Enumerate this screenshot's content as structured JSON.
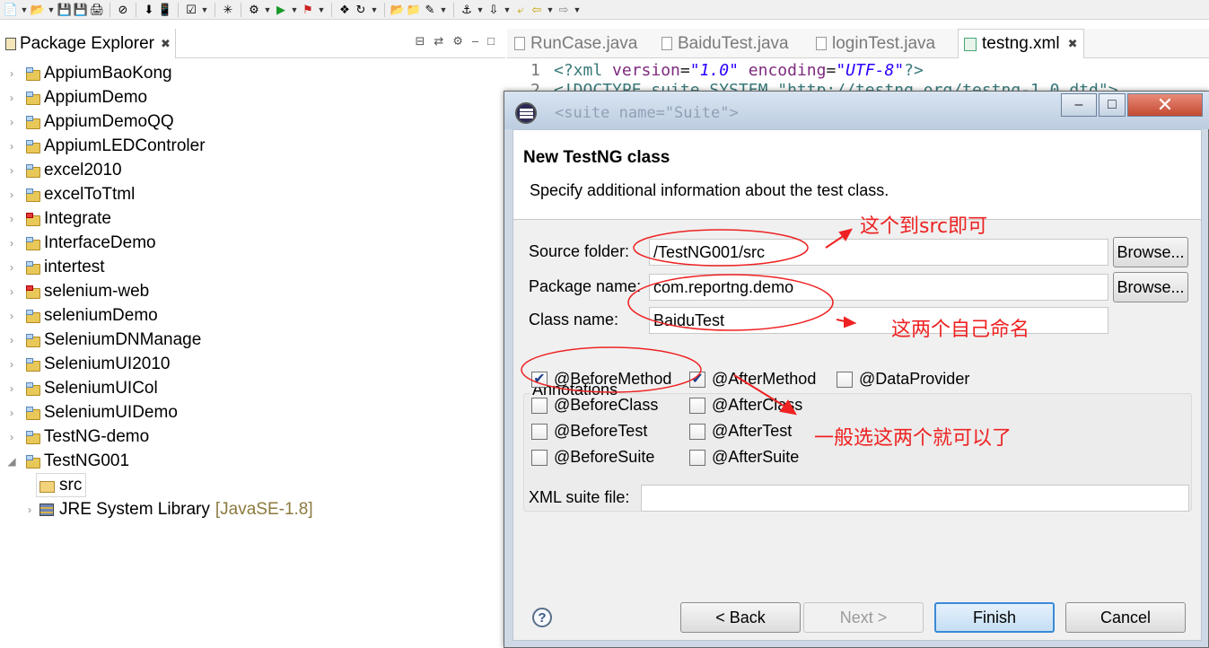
{
  "toolbar": {
    "icons": [
      "new-icon",
      "open-icon",
      "save-icon",
      "save-all-icon",
      "print-icon",
      "skip-breakpoints-icon",
      "download-icon",
      "phone-icon",
      "checkbox-icon",
      "new-class-icon",
      "debug-icon",
      "run-icon",
      "external-tools-icon",
      "package-icon",
      "refresh-icon",
      "open-folder-icon",
      "folder-icon",
      "pen-icon",
      "pin-icon",
      "next-icon",
      "prev-icon",
      "back-icon",
      "forward-icon"
    ]
  },
  "explorer": {
    "tab_label": "Package Explorer",
    "projects": [
      {
        "label": "AppiumBaoKong",
        "error": false
      },
      {
        "label": "AppiumDemo",
        "error": false
      },
      {
        "label": "AppiumDemoQQ",
        "error": false
      },
      {
        "label": "AppiumLEDControler",
        "error": false
      },
      {
        "label": "excel2010",
        "error": false
      },
      {
        "label": "excelToTtml",
        "error": false
      },
      {
        "label": "Integrate",
        "error": true
      },
      {
        "label": "InterfaceDemo",
        "error": false
      },
      {
        "label": "intertest",
        "error": false
      },
      {
        "label": "selenium-web",
        "error": true
      },
      {
        "label": "seleniumDemo",
        "error": false
      },
      {
        "label": "SeleniumDNManage",
        "error": false
      },
      {
        "label": "SeleniumUI2010",
        "error": false
      },
      {
        "label": "SeleniumUICol",
        "error": false
      },
      {
        "label": "SeleniumUIDemo",
        "error": false
      },
      {
        "label": "TestNG-demo",
        "error": false
      },
      {
        "label": "TestNG001",
        "error": false
      }
    ],
    "src_label": "src",
    "library_label": "JRE System Library",
    "library_suffix": "[JavaSE-1.8]"
  },
  "editor": {
    "tabs": [
      {
        "label": "RunCase.java",
        "active": false
      },
      {
        "label": "BaiduTest.java",
        "active": false
      },
      {
        "label": "loginTest.java",
        "active": false
      },
      {
        "label": "testng.xml",
        "active": true
      }
    ],
    "line1": {
      "num": "1",
      "p1": "<?xml ",
      "a1": "version",
      "eq1": "=",
      "v1": "\"1.0\"",
      "sp": " ",
      "a2": "encoding",
      "eq2": "=",
      "v2": "\"UTF-8\"",
      "end": "?>"
    },
    "line2": {
      "num": "2",
      "text": "<!DOCTYPE suite SYSTEM \"http://testng.org/testng-1.0.dtd\">"
    },
    "line3": {
      "text": "<suite name=\"Suite\">"
    }
  },
  "dialog": {
    "heading": "New TestNG class",
    "description": "Specify additional information about the test class.",
    "source_folder": {
      "label": "Source folder:",
      "value": "/TestNG001/src",
      "browse": "Browse..."
    },
    "package_name": {
      "label": "Package name:",
      "value": "com.reportng.demo",
      "browse": "Browse..."
    },
    "class_name": {
      "label": "Class name:",
      "value": "BaiduTest"
    },
    "annotations_label": "Annotations",
    "annotations": [
      {
        "label": "@BeforeMethod",
        "checked": true
      },
      {
        "label": "@AfterMethod",
        "checked": true
      },
      {
        "label": "@DataProvider",
        "checked": false
      },
      {
        "label": "@BeforeClass",
        "checked": false
      },
      {
        "label": "@AfterClass",
        "checked": false
      },
      {
        "label": "@BeforeTest",
        "checked": false
      },
      {
        "label": "@AfterTest",
        "checked": false
      },
      {
        "label": "@BeforeSuite",
        "checked": false
      },
      {
        "label": "@AfterSuite",
        "checked": false
      }
    ],
    "xml_suite": {
      "label": "XML suite file:",
      "value": ""
    },
    "help": "?",
    "buttons": {
      "back": "< Back",
      "next": "Next >",
      "finish": "Finish",
      "cancel": "Cancel"
    }
  },
  "notes": {
    "src_note": "这个到src即可",
    "naming_note": "这两个自己命名",
    "select_note": "一般选这两个就可以了"
  },
  "colors": {
    "annotation_red": "#ee2222",
    "dialog_frame": "#cfd9e6",
    "default_button": "#3a8ad6"
  }
}
